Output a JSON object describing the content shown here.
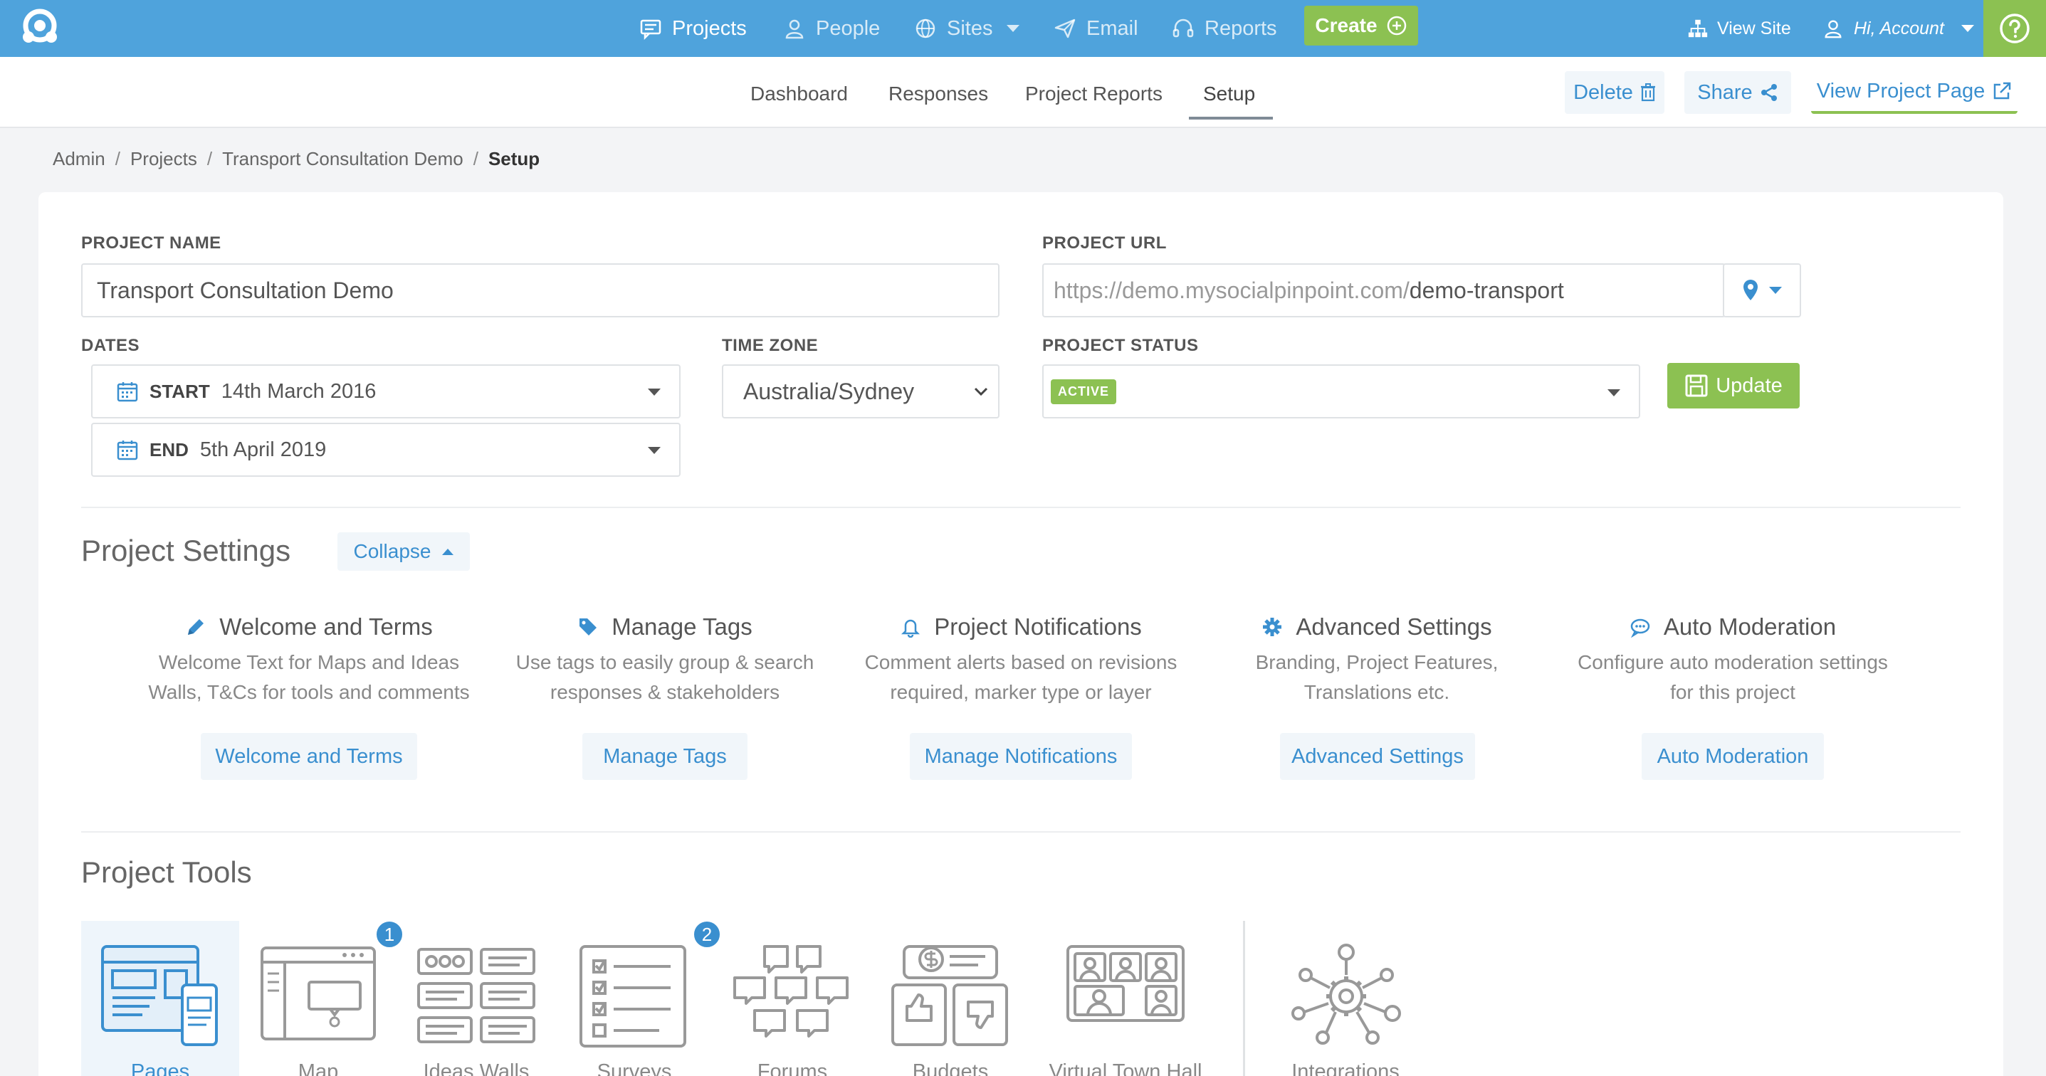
{
  "nav": {
    "items": [
      {
        "label": "Projects",
        "icon": "chat-icon"
      },
      {
        "label": "People",
        "icon": "user-icon"
      },
      {
        "label": "Sites",
        "icon": "globe-icon"
      },
      {
        "label": "Email",
        "icon": "send-icon"
      },
      {
        "label": "Reports",
        "icon": "headset-icon"
      }
    ],
    "create_label": "Create",
    "view_site_label": "View Site",
    "account_label": "Hi, Account"
  },
  "subnav": {
    "tabs": [
      "Dashboard",
      "Responses",
      "Project Reports",
      "Setup"
    ],
    "active": "Setup",
    "delete_label": "Delete",
    "share_label": "Share",
    "view_project_label": "View Project Page"
  },
  "breadcrumb": [
    "Admin",
    "Projects",
    "Transport Consultation Demo",
    "Setup"
  ],
  "form": {
    "project_name_label": "PROJECT NAME",
    "project_name_value": "Transport Consultation Demo",
    "project_url_label": "PROJECT URL",
    "project_url_prefix": "https://demo.mysocialpinpoint.com/",
    "project_url_slug": "demo-transport",
    "dates_label": "DATES",
    "start_kw": "START",
    "start_value": "14th March 2016",
    "end_kw": "END",
    "end_value": "5th April 2019",
    "timezone_label": "TIME ZONE",
    "timezone_value": "Australia/Sydney",
    "status_label": "PROJECT STATUS",
    "status_value": "ACTIVE",
    "update_label": "Update"
  },
  "settings": {
    "title": "Project Settings",
    "collapse_label": "Collapse",
    "items": [
      {
        "title": "Welcome and Terms",
        "desc1": "Welcome Text for Maps and Ideas",
        "desc2": "Walls, T&Cs for tools and comments",
        "button": "Welcome and Terms"
      },
      {
        "title": "Manage Tags",
        "desc1": "Use tags to easily group & search",
        "desc2": "responses & stakeholders",
        "button": "Manage Tags"
      },
      {
        "title": "Project Notifications",
        "desc1": "Comment alerts based on revisions",
        "desc2": "required, marker type or layer",
        "button": "Manage Notifications"
      },
      {
        "title": "Advanced Settings",
        "desc1": "Branding, Project Features,",
        "desc2": "Translations etc.",
        "button": "Advanced Settings"
      },
      {
        "title": "Auto Moderation",
        "desc1": "Configure auto moderation settings",
        "desc2": "for this project",
        "button": "Auto Moderation"
      }
    ]
  },
  "tools": {
    "title": "Project Tools",
    "items": [
      {
        "label": "Pages"
      },
      {
        "label": "Map",
        "badge": "1"
      },
      {
        "label": "Ideas Walls"
      },
      {
        "label": "Surveys",
        "badge": "2"
      },
      {
        "label": "Forums"
      },
      {
        "label": "Budgets"
      },
      {
        "label": "Virtual Town Hall"
      },
      {
        "label": "Integrations"
      }
    ]
  },
  "colors": {
    "nav_bg": "#4fa3dc",
    "accent_green": "#8cc152",
    "link_blue": "#3a8fcf"
  }
}
